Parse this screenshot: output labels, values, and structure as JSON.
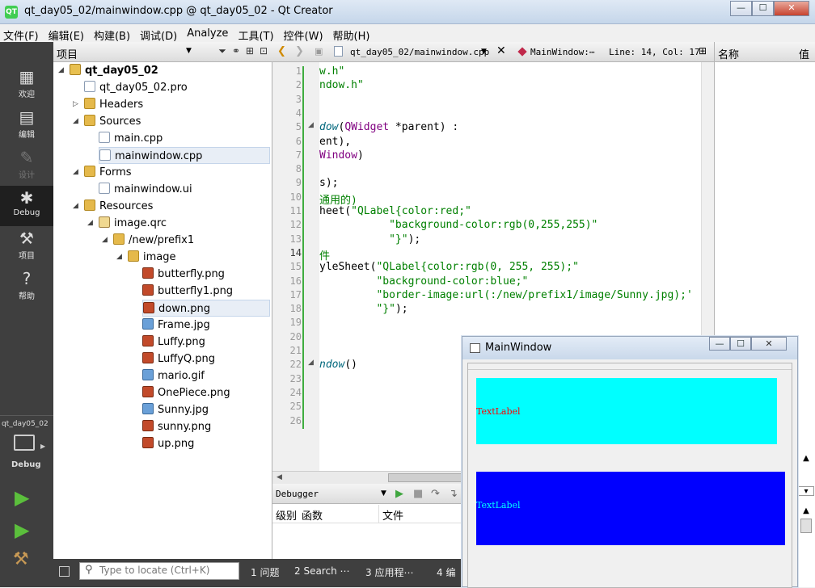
{
  "window": {
    "title": "qt_day05_02/mainwindow.cpp @ qt_day05_02 - Qt Creator",
    "app_icon": "QT"
  },
  "window_controls": {
    "minimize": "—",
    "maximize": "☐",
    "close": "✕"
  },
  "menu": [
    "文件(F)",
    "编辑(E)",
    "构建(B)",
    "调试(D)",
    "Analyze",
    "工具(T)",
    "控件(W)",
    "帮助(H)"
  ],
  "modes": [
    {
      "label": "欢迎",
      "icon": "grid-icon"
    },
    {
      "label": "编辑",
      "icon": "document-icon"
    },
    {
      "label": "设计",
      "icon": "pen-icon"
    },
    {
      "label": "Debug",
      "icon": "bug-icon"
    },
    {
      "label": "项目",
      "icon": "wrench-icon"
    },
    {
      "label": "帮助",
      "icon": "help-icon"
    }
  ],
  "kit": {
    "project": "qt_day05_02",
    "config": "Debug"
  },
  "project_panel": {
    "title": "项目"
  },
  "tree": [
    {
      "label": "qt_day05_02",
      "icon": "proj",
      "level": 0,
      "arrow": "down",
      "bold": true
    },
    {
      "label": "qt_day05_02.pro",
      "icon": "file",
      "level": 1
    },
    {
      "label": "Headers",
      "icon": "folder",
      "level": 1,
      "arrow": "right"
    },
    {
      "label": "Sources",
      "icon": "folder",
      "level": 1,
      "arrow": "down"
    },
    {
      "label": "main.cpp",
      "icon": "file",
      "level": 2
    },
    {
      "label": "mainwindow.cpp",
      "icon": "file",
      "level": 2,
      "selected": true
    },
    {
      "label": "Forms",
      "icon": "folder",
      "level": 1,
      "arrow": "down"
    },
    {
      "label": "mainwindow.ui",
      "icon": "file",
      "level": 2
    },
    {
      "label": "Resources",
      "icon": "folder",
      "level": 1,
      "arrow": "down"
    },
    {
      "label": "image.qrc",
      "icon": "qrc",
      "level": 2,
      "arrow": "down"
    },
    {
      "label": "/new/prefix1",
      "icon": "folder",
      "level": 3,
      "arrow": "down"
    },
    {
      "label": "image",
      "icon": "folder",
      "level": 4,
      "arrow": "down"
    },
    {
      "label": "butterfly.png",
      "icon": "img",
      "level": 5
    },
    {
      "label": "butterfly1.png",
      "icon": "img",
      "level": 5
    },
    {
      "label": "down.png",
      "icon": "img",
      "level": 5,
      "selected": true
    },
    {
      "label": "Frame.jpg",
      "icon": "jpg",
      "level": 5
    },
    {
      "label": "Luffy.png",
      "icon": "img",
      "level": 5
    },
    {
      "label": "LuffyQ.png",
      "icon": "img",
      "level": 5
    },
    {
      "label": "mario.gif",
      "icon": "jpg",
      "level": 5
    },
    {
      "label": "OnePiece.png",
      "icon": "img",
      "level": 5
    },
    {
      "label": "Sunny.jpg",
      "icon": "jpg",
      "level": 5
    },
    {
      "label": "sunny.png",
      "icon": "img",
      "level": 5
    },
    {
      "label": "up.png",
      "icon": "img",
      "level": 5
    }
  ],
  "editor": {
    "file": "qt_day05_02/mainwindow.cpp",
    "symbol": "MainWindow:⋯",
    "position": "Line: 14, Col: 17",
    "current_line": 14,
    "lines": [
      [
        [
          "str",
          "w.h\""
        ]
      ],
      [
        [
          "str",
          "ndow.h\""
        ]
      ],
      [],
      [],
      [
        [
          "fn",
          "dow"
        ],
        [
          "",
          "("
        ],
        [
          "ty",
          "QWidget"
        ],
        [
          "",
          " *parent) :"
        ]
      ],
      [
        [
          "",
          "ent),"
        ]
      ],
      [
        [
          "ty",
          "Window"
        ],
        [
          "",
          ")"
        ]
      ],
      [],
      [
        [
          "",
          "s);"
        ]
      ],
      [
        [
          "cmt",
          "通用的)"
        ]
      ],
      [
        [
          "",
          "heet("
        ],
        [
          "str",
          "\"QLabel{color:red;\""
        ]
      ],
      [
        [
          "",
          "           "
        ],
        [
          "str",
          "\"background-color:rgb(0,255,255)\""
        ]
      ],
      [
        [
          "",
          "           "
        ],
        [
          "str",
          "\"}\""
        ],
        [
          "",
          ");"
        ]
      ],
      [
        [
          "cmt",
          "件"
        ]
      ],
      [
        [
          "",
          "yleSheet("
        ],
        [
          "str",
          "\"QLabel{color:rgb(0, 255, 255);\""
        ]
      ],
      [
        [
          "",
          "         "
        ],
        [
          "str",
          "\"background-color:blue;\""
        ]
      ],
      [
        [
          "",
          "         "
        ],
        [
          "str",
          "\"border-image:url(:/new/prefix1/image/Sunny.jpg);'"
        ]
      ],
      [
        [
          "",
          "         "
        ],
        [
          "str",
          "\"}\""
        ],
        [
          "",
          ");"
        ]
      ],
      [],
      [],
      [],
      [
        [
          "fn",
          "ndow"
        ],
        [
          "",
          "()"
        ]
      ],
      [],
      [],
      [],
      []
    ]
  },
  "debugger": {
    "title": "Debugger",
    "columns": [
      "级别",
      "函数",
      "文件"
    ]
  },
  "right_panel": {
    "col1": "名称",
    "col2": "值"
  },
  "statusbar": {
    "locate_placeholder": "Type to locate (Ctrl+K)",
    "tabs": [
      "1 问题",
      "2 Search ⋯",
      "3 应用程⋯",
      "4 编"
    ]
  },
  "main_window": {
    "title": "MainWindow",
    "label1": "TextLabel",
    "label2": "TextLabel",
    "label1_bg": "#00ffff",
    "label1_fg": "#ff0000",
    "label2_bg": "#0000ff",
    "label2_fg": "#00ffff"
  }
}
